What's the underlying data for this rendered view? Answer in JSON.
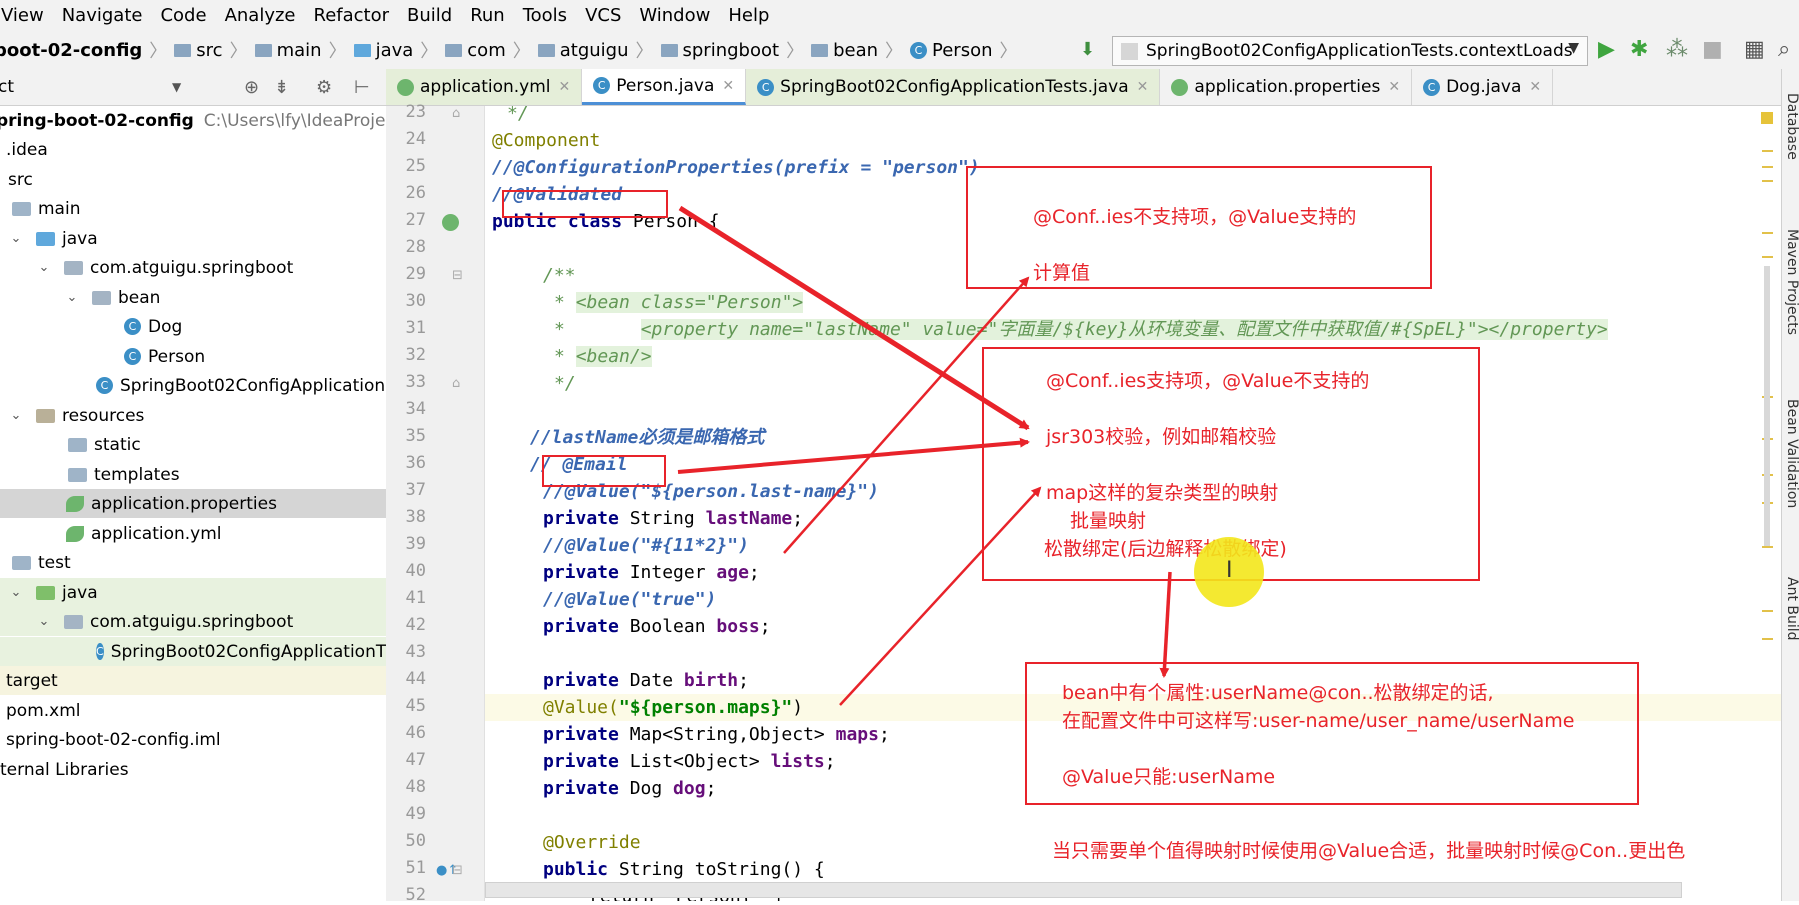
{
  "menu": [
    "View",
    "Navigate",
    "Code",
    "Analyze",
    "Refactor",
    "Build",
    "Run",
    "Tools",
    "VCS",
    "Window",
    "Help"
  ],
  "breadcrumb": [
    "boot-02-config",
    "src",
    "main",
    "java",
    "com",
    "atguigu",
    "springboot",
    "bean",
    "Person"
  ],
  "run_config": "SpringBoot02ConfigApplicationTests.contextLoads",
  "project_header": "ct",
  "tree": [
    {
      "label": "pring-boot-02-config",
      "hint": "C:\\Users\\lfy\\IdeaProjects",
      "bold": true
    },
    {
      "label": ".idea"
    },
    {
      "label": "src"
    },
    {
      "label": "main"
    },
    {
      "label": "java"
    },
    {
      "label": "com.atguigu.springboot"
    },
    {
      "label": "bean"
    },
    {
      "label": "Dog"
    },
    {
      "label": "Person"
    },
    {
      "label": "SpringBoot02ConfigApplication"
    },
    {
      "label": "resources"
    },
    {
      "label": "static"
    },
    {
      "label": "templates"
    },
    {
      "label": "application.properties"
    },
    {
      "label": "application.yml"
    },
    {
      "label": "test"
    },
    {
      "label": "java"
    },
    {
      "label": "com.atguigu.springboot"
    },
    {
      "label": "SpringBoot02ConfigApplicationT"
    },
    {
      "label": "target"
    },
    {
      "label": "pom.xml"
    },
    {
      "label": "spring-boot-02-config.iml"
    },
    {
      "label": "ternal Libraries"
    }
  ],
  "tabs": [
    "application.yml",
    "Person.java",
    "SpringBoot02ConfigApplicationTests.java",
    "application.properties",
    "Dog.java"
  ],
  "line_numbers": [
    "23",
    "24",
    "25",
    "26",
    "27",
    "28",
    "29",
    "30",
    "31",
    "32",
    "33",
    "34",
    "35",
    "36",
    "37",
    "38",
    "39",
    "40",
    "41",
    "42",
    "43",
    "44",
    "45",
    "46",
    "47",
    "48",
    "49",
    "50",
    "51",
    "52"
  ],
  "code": {
    "l23": "*/",
    "l24": "@Component",
    "l25": "//@ConfigurationProperties(prefix = \"person\")",
    "l26": "//@Validated",
    "l27_kw": "public class",
    "l27_rest": " Person {",
    "l29": "/**",
    "l30_a": "* ",
    "l30_b": "<bean class=\"Person\">",
    "l31_a": "*       ",
    "l31_b": "<property name=\"lastName\" value=\"字面量/${key}从环境变量、配置文件中获取值/#{SpEL}\"></property>",
    "l32_a": "* ",
    "l32_b": "<bean/>",
    "l33": "*/",
    "l35": "//lastName必须是邮箱格式",
    "l36": "// @Email",
    "l37": "//@Value(\"${person.last-name}\")",
    "l38_kw": "private",
    "l38_t": " String ",
    "l38_f": "lastName",
    "l38_e": ";",
    "l39": "//@Value(\"#{11*2}\")",
    "l40_kw": "private",
    "l40_t": " Integer ",
    "l40_f": "age",
    "l40_e": ";",
    "l41": "//@Value(\"true\")",
    "l42_kw": "private",
    "l42_t": " Boolean ",
    "l42_f": "boss",
    "l42_e": ";",
    "l44_kw": "private",
    "l44_t": " Date ",
    "l44_f": "birth",
    "l44_e": ";",
    "l45_a": "@Value(",
    "l45_s": "\"${person.maps}\"",
    "l45_e": ")",
    "l46_kw": "private",
    "l46_t": " Map<String,Object> ",
    "l46_f": "maps",
    "l46_e": ";",
    "l47_kw": "private",
    "l47_t": " List<Object> ",
    "l47_f": "lists",
    "l47_e": ";",
    "l48_kw": "private",
    "l48_t": " Dog ",
    "l48_f": "dog",
    "l48_e": ";",
    "l50": "@Override",
    "l51_kw": "public",
    "l51_t": " String toString() {",
    "l52": "return \"Person{\" +"
  },
  "right_strip": [
    "Database",
    "Maven Projects",
    "Bean Validation",
    "Ant Build"
  ],
  "notes": {
    "n1": "@Conf..ies不支持项，@Value支持的",
    "n2": "计算值",
    "n3": "@Conf..ies支持项，@Value不支持的",
    "n4": "jsr303校验，例如邮箱校验",
    "n5": "map这样的复杂类型的映射",
    "n6": "批量映射",
    "n7": "松散绑定(后边解释松散绑定)",
    "n8": "bean中有个属性:userName@con..松散绑定的话,",
    "n9": "在配置文件中可这样写:user-name/user_name/userName",
    "n10": "@Value只能:userName",
    "n11": "当只需要单个值得映射时候使用@Value合适，批量映射时候@Con..更出色"
  },
  "colors": {
    "annotation_red": "#e8232a",
    "keyword": "#000080",
    "doc_green": "#629755",
    "field": "#660e7a"
  }
}
